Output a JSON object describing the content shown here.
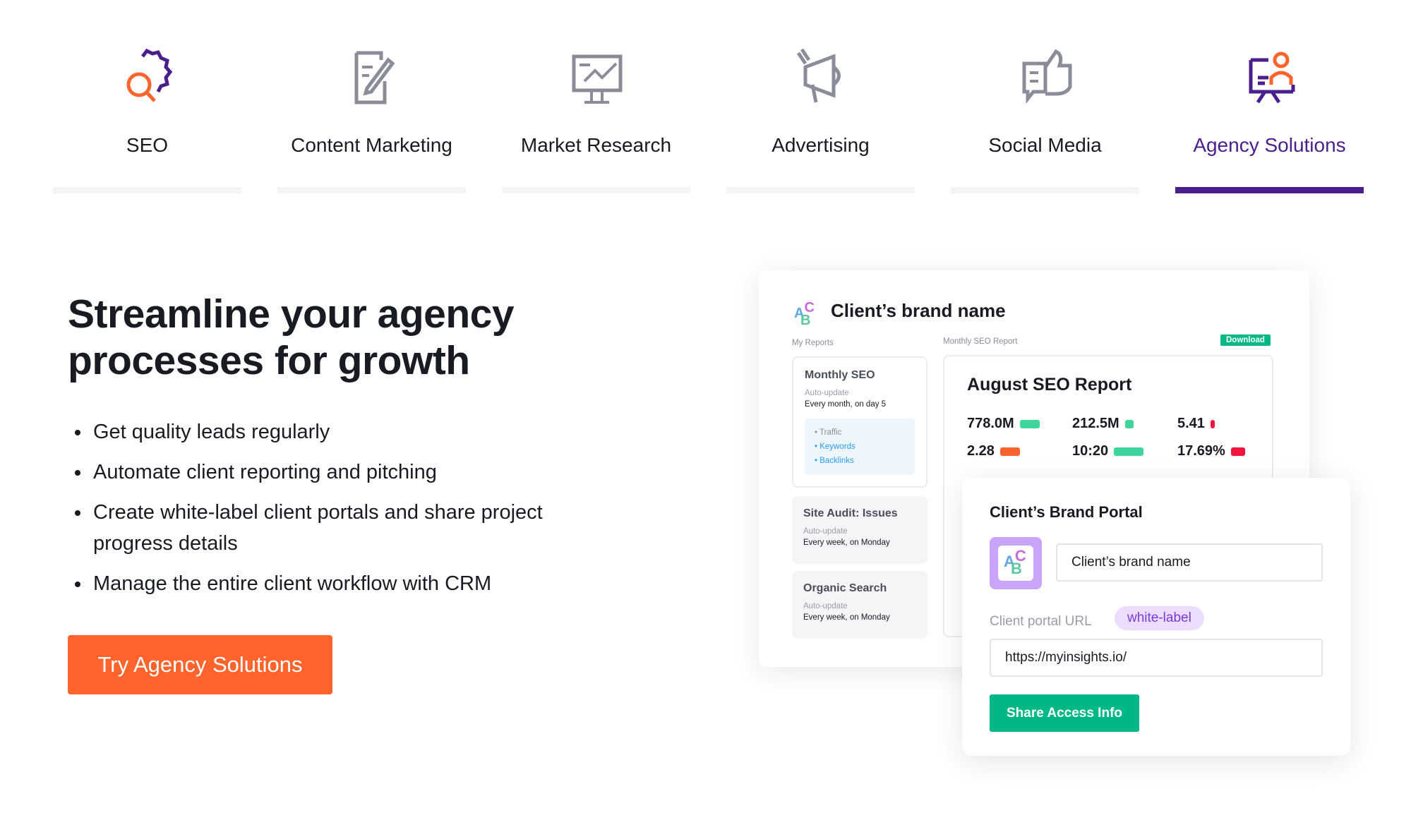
{
  "tabs": [
    {
      "label": "SEO",
      "icon": "seo-gear-magnifier-icon",
      "active": false
    },
    {
      "label": "Content Marketing",
      "icon": "edit-document-icon",
      "active": false
    },
    {
      "label": "Market Research",
      "icon": "monitor-chart-icon",
      "active": false
    },
    {
      "label": "Advertising",
      "icon": "megaphone-icon",
      "active": false
    },
    {
      "label": "Social Media",
      "icon": "thumbs-up-chat-icon",
      "active": false
    },
    {
      "label": "Agency Solutions",
      "icon": "presenter-board-icon",
      "active": true
    }
  ],
  "hero": {
    "title": "Streamline your agency processes for growth",
    "bullets": [
      "Get quality leads regularly",
      "Automate client reporting and pitching",
      "Create white-label client portals and share project progress details",
      "Manage the entire client workflow with CRM"
    ],
    "cta": "Try Agency Solutions"
  },
  "mockup": {
    "brand": "Client’s brand name",
    "my_reports": "My Reports",
    "monthly_report_label": "Monthly SEO Report",
    "download": "Download",
    "reports": [
      {
        "title": "Monthly SEO",
        "auto": "Auto-update",
        "schedule": "Every month, on day 5",
        "links": [
          "Traffic",
          "Keywords",
          "Backlinks"
        ]
      },
      {
        "title": "Site Audit: Issues",
        "auto": "Auto-update",
        "schedule": "Every week, on Monday"
      },
      {
        "title": "Organic Search",
        "auto": "Auto-update",
        "schedule": "Every week, on Monday"
      }
    ],
    "report_title": "August SEO Report",
    "metrics": [
      {
        "value": "778.0M",
        "color": "#3fd69d"
      },
      {
        "value": "212.5M",
        "color": "#3fd69d"
      },
      {
        "value": "5.41",
        "color": "#f2163f"
      },
      {
        "value": "2.28",
        "color": "#ff642d"
      },
      {
        "value": "10:20",
        "color": "#3fd69d"
      },
      {
        "value": "17.69%",
        "color": "#f2163f"
      }
    ]
  },
  "portal": {
    "title": "Client’s Brand Portal",
    "name_value": "Client’s brand name",
    "url_label": "Client portal URL",
    "badge": "white-label",
    "url_value": "https://myinsights.io/",
    "share": "Share Access Info"
  },
  "colors": {
    "accent": "#4b1e8e",
    "cta": "#ff642d",
    "green": "#00b886"
  }
}
